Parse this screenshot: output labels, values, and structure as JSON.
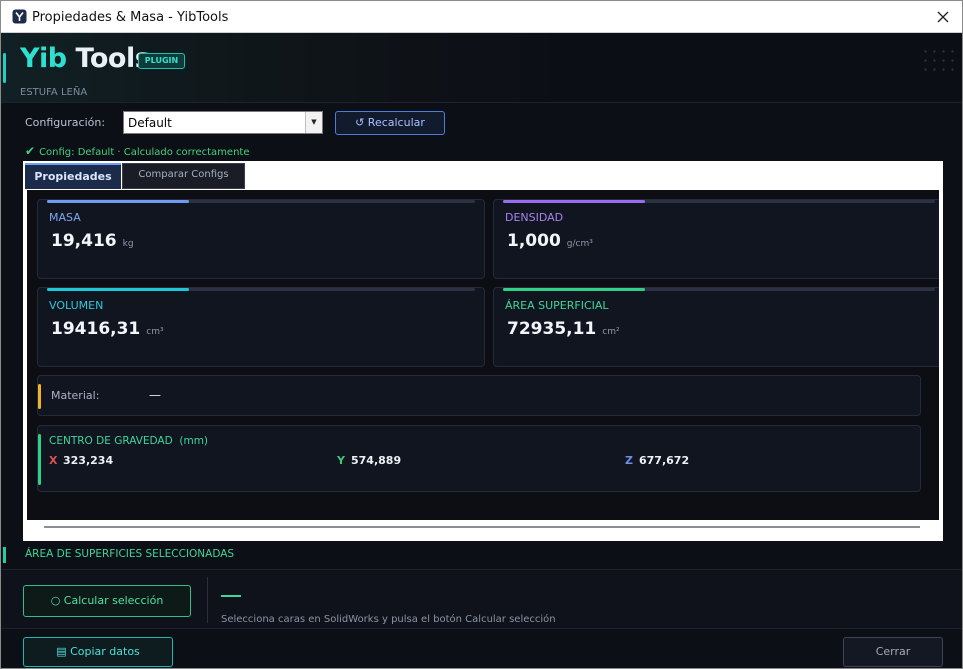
{
  "window": {
    "title": "Propiedades & Masa - YibTools"
  },
  "header": {
    "brand_a": "Yib",
    "brand_b": "Tools",
    "badge": "PLUGIN",
    "part_name": "ESTUFA LEÑA"
  },
  "config": {
    "label": "Configuración:",
    "selected": "Default",
    "recalc_label": "↺ Recalcular",
    "status_text": "Config: Default · Calculado correctamente",
    "status_color": "#44d27e"
  },
  "tabs": [
    {
      "label": "Propiedades",
      "active": true
    },
    {
      "label": "Comparar Configs",
      "active": false
    }
  ],
  "metrics": {
    "masa": {
      "label": "MASA",
      "value": "19,416",
      "unit": "kg",
      "color": "#6f9cf0"
    },
    "densidad": {
      "label": "DENSIDAD",
      "value": "1,000",
      "unit": "g/cm³",
      "color": "#9a6cf0"
    },
    "volumen": {
      "label": "VOLUMEN",
      "value": "19416,31",
      "unit": "cm³",
      "color": "#1fc8d8"
    },
    "area": {
      "label": "ÁREA SUPERFICIAL",
      "value": "72935,11",
      "unit": "cm²",
      "color": "#2fd08a"
    }
  },
  "material": {
    "label": "Material:",
    "value": "—",
    "accent": "#f0b428"
  },
  "cog": {
    "title": "CENTRO DE GRAVEDAD  (mm)",
    "accent": "#2fd08a",
    "x_label": "X",
    "x_value": "323,234",
    "x_color": "#e05050",
    "y_label": "Y",
    "y_value": "574,889",
    "y_color": "#3fc87a",
    "z_label": "Z",
    "z_value": "677,672",
    "z_color": "#6f8fe0"
  },
  "selection": {
    "title": "ÁREA DE SUPERFICIES SELECCIONADAS",
    "button_label": "○ Calcular selección",
    "hint": "Selecciona caras en SolidWorks y pulsa el botón Calcular selección"
  },
  "footer": {
    "copy_label": "▤ Copiar datos",
    "close_label": "Cerrar"
  }
}
